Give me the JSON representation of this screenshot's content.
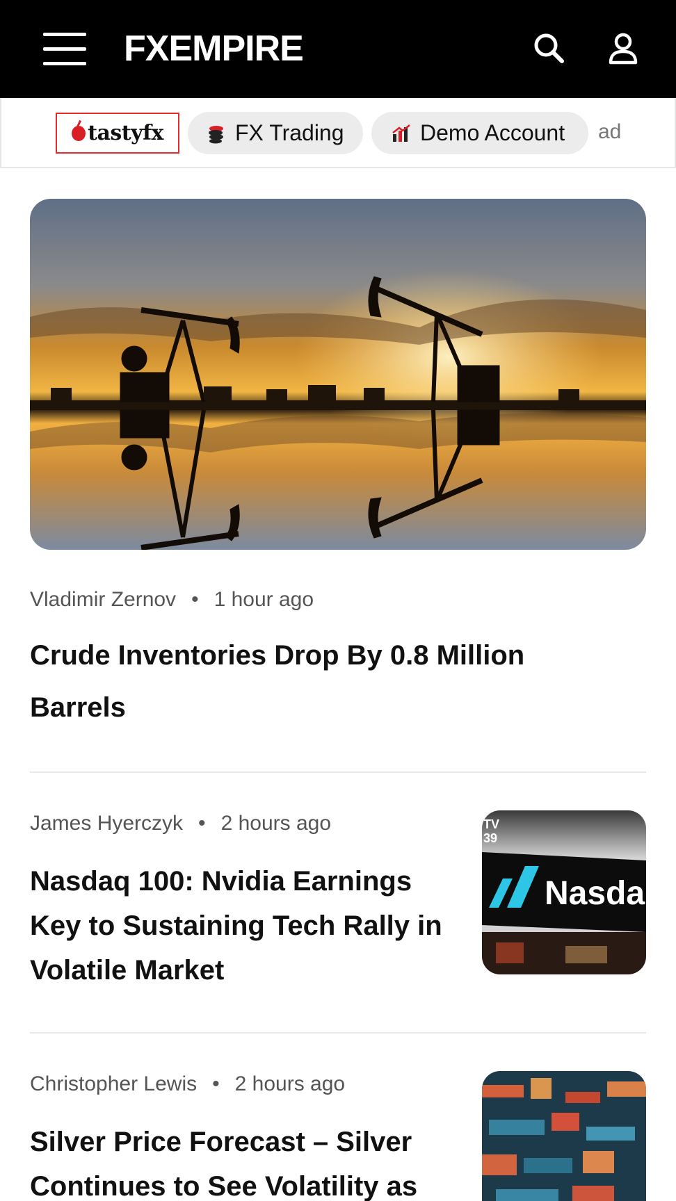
{
  "header": {
    "logo": "FXEMPIRE",
    "icons": [
      "menu-icon",
      "search-icon",
      "user-icon"
    ]
  },
  "ad_strip": {
    "sponsor": "tastyfx",
    "pills": [
      {
        "label": "FX Trading",
        "icon": "coins-icon"
      },
      {
        "label": "Demo Account",
        "icon": "bar-chart-icon"
      }
    ],
    "ad_label": "ad",
    "colors": {
      "sponsor_border": "#e32b2b",
      "pill_bg": "#ececec"
    }
  },
  "articles": [
    {
      "author": "Vladimir Zernov",
      "time": "1 hour ago",
      "title": "Crude Inventories Drop By 0.8 Million Barrels",
      "image": "oil-pumpjacks-sunset-image"
    },
    {
      "author": "James Hyerczyk",
      "time": "2 hours ago",
      "title": "Nasdaq 100: Nvidia Earnings Key to Sustaining Tech Rally in Volatile Market",
      "image": "nasdaq-sign-image",
      "image_text": "Nasda"
    },
    {
      "author": "Christopher Lewis",
      "time": "2 hours ago",
      "title": "Silver Price Forecast – Silver Continues to See Volatility as",
      "image": "abstract-chart-image"
    }
  ]
}
